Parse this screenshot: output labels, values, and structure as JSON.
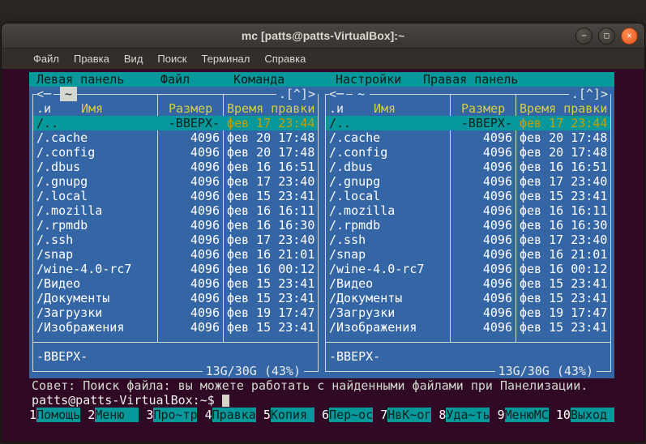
{
  "window": {
    "title": "mc [patts@patts-VirtualBox]:~",
    "buttons": {
      "minimize": "−",
      "maximize": "□",
      "close": "✕"
    }
  },
  "terminal_menu": {
    "items": [
      "Файл",
      "Правка",
      "Вид",
      "Поиск",
      "Терминал",
      "Справка"
    ]
  },
  "mc": {
    "menu": [
      "Левая панель",
      "Файл",
      "Команда",
      "Настройки",
      "Правая панель"
    ],
    "panel": {
      "back_arrow": "<─",
      "tab": "~",
      "updir_button": ".[^]>",
      "headers": {
        "sort": ".и",
        "name": "Имя",
        "size": "Размер",
        "mtime": "Время правки"
      },
      "rows": [
        {
          "name": "/..",
          "size": "-ВВЕРХ-",
          "time": "фев 17 23:44",
          "selected": true
        },
        {
          "name": "/.cache",
          "size": "4096",
          "time": "фев 20 17:48",
          "selected": false
        },
        {
          "name": "/.config",
          "size": "4096",
          "time": "фев 20 17:48",
          "selected": false
        },
        {
          "name": "/.dbus",
          "size": "4096",
          "time": "фев 16 16:51",
          "selected": false
        },
        {
          "name": "/.gnupg",
          "size": "4096",
          "time": "фев 17 23:40",
          "selected": false
        },
        {
          "name": "/.local",
          "size": "4096",
          "time": "фев 15 23:41",
          "selected": false
        },
        {
          "name": "/.mozilla",
          "size": "4096",
          "time": "фев 16 16:11",
          "selected": false
        },
        {
          "name": "/.rpmdb",
          "size": "4096",
          "time": "фев 16 16:30",
          "selected": false
        },
        {
          "name": "/.ssh",
          "size": "4096",
          "time": "фев 17 23:40",
          "selected": false
        },
        {
          "name": "/snap",
          "size": "4096",
          "time": "фев 16 21:01",
          "selected": false
        },
        {
          "name": "/wine-4.0-rc7",
          "size": "4096",
          "time": "фев 16 00:12",
          "selected": false
        },
        {
          "name": "/Видео",
          "size": "4096",
          "time": "фев 15 23:41",
          "selected": false
        },
        {
          "name": "/Документы",
          "size": "4096",
          "time": "фев 15 23:41",
          "selected": false
        },
        {
          "name": "/Загрузки",
          "size": "4096",
          "time": "фев 19 17:47",
          "selected": false
        },
        {
          "name": "/Изображения",
          "size": "4096",
          "time": "фев 15 23:41",
          "selected": false
        }
      ],
      "mini_status": "-ВВЕРХ-",
      "free_space": "13G/30G (43%)"
    },
    "hint": "Совет: Поиск файла: вы можете работать с найденными файлами при Панелизации.",
    "prompt": "patts@patts-VirtualBox:~$",
    "fkeys": [
      {
        "num": "1",
        "label": "Помощь"
      },
      {
        "num": "2",
        "label": "Меню"
      },
      {
        "num": "3",
        "label": "Про~тр"
      },
      {
        "num": "4",
        "label": "Правка"
      },
      {
        "num": "5",
        "label": "Копия"
      },
      {
        "num": "6",
        "label": "Пер~ос"
      },
      {
        "num": "7",
        "label": "НвК~ог"
      },
      {
        "num": "8",
        "label": "Уда~ть"
      },
      {
        "num": "9",
        "label": "МенюМС"
      },
      {
        "num": "10",
        "label": "Выход"
      }
    ]
  },
  "colors": {
    "terminal_bg": "#300A24",
    "panel_blue": "#3465A4",
    "cyan": "#06989A",
    "frame_white": "#D3D7CF",
    "header_yellow": "#D6CE46",
    "selected_time_yellow": "#C4A000",
    "close_orange": "#E95420"
  }
}
